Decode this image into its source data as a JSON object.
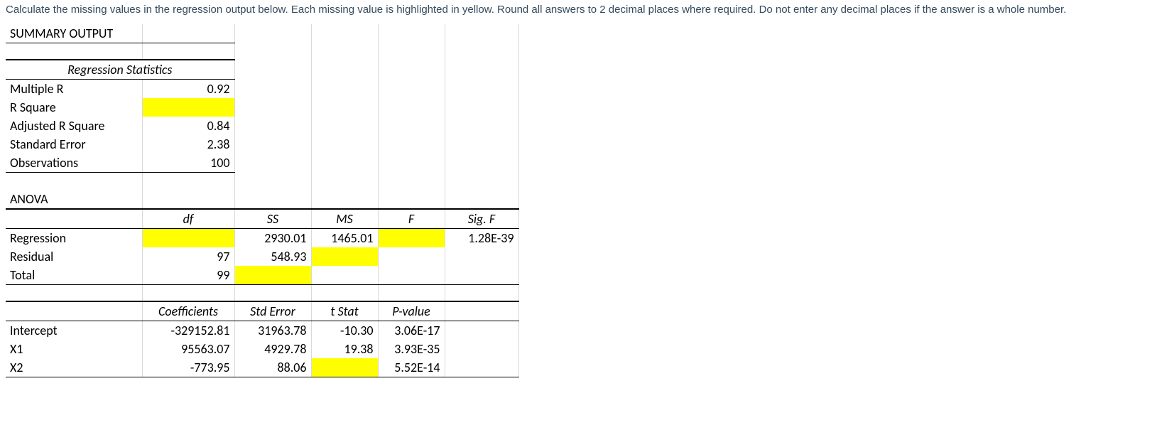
{
  "instruction": "Calculate the missing values in the regression output below. Each missing value is highlighted in yellow. Round all answers to 2 decimal places where required. Do not enter any decimal places if the answer is a whole number.",
  "summary_output": "SUMMARY OUTPUT",
  "reg_stats_header": "Regression Statistics",
  "stats": {
    "multiple_r": {
      "label": "Multiple R",
      "value": "0.92"
    },
    "r_square": {
      "label": "R Square",
      "value": ""
    },
    "adj_r_square": {
      "label": "Adjusted R Square",
      "value": "0.84"
    },
    "std_error": {
      "label": "Standard Error",
      "value": "2.38"
    },
    "observations": {
      "label": "Observations",
      "value": "100"
    }
  },
  "anova": {
    "title": "ANOVA",
    "headers": {
      "df": "df",
      "ss": "SS",
      "ms": "MS",
      "f": "F",
      "sigf": "Sig. F"
    },
    "rows": {
      "regression": {
        "label": "Regression",
        "df": "",
        "ss": "2930.01",
        "ms": "1465.01",
        "f": "",
        "sigf": "1.28E-39"
      },
      "residual": {
        "label": "Residual",
        "df": "97",
        "ss": "548.93",
        "ms": "",
        "f": "",
        "sigf": ""
      },
      "total": {
        "label": "Total",
        "df": "99",
        "ss": "",
        "ms": "",
        "f": "",
        "sigf": ""
      }
    }
  },
  "coef": {
    "headers": {
      "coef": "Coefficients",
      "se": "Std Error",
      "t": "t Stat",
      "p": "P-value"
    },
    "rows": {
      "intercept": {
        "label": "Intercept",
        "coef": "-329152.81",
        "se": "31963.78",
        "t": "-10.30",
        "p": "3.06E-17"
      },
      "x1": {
        "label": "X1",
        "coef": "95563.07",
        "se": "4929.78",
        "t": "19.38",
        "p": "3.93E-35"
      },
      "x2": {
        "label": "X2",
        "coef": "-773.95",
        "se": "88.06",
        "t": "",
        "p": "5.52E-14"
      }
    }
  },
  "chart_data": {
    "type": "table",
    "title": "Regression SUMMARY OUTPUT (missing cells highlighted)",
    "regression_statistics": {
      "Multiple R": 0.92,
      "R Square": null,
      "Adjusted R Square": 0.84,
      "Standard Error": 2.38,
      "Observations": 100
    },
    "anova": {
      "columns": [
        "",
        "df",
        "SS",
        "MS",
        "F",
        "Sig. F"
      ],
      "rows": [
        [
          "Regression",
          null,
          2930.01,
          1465.01,
          null,
          "1.28E-39"
        ],
        [
          "Residual",
          97,
          548.93,
          null,
          "",
          ""
        ],
        [
          "Total",
          99,
          null,
          "",
          "",
          ""
        ]
      ]
    },
    "coefficients": {
      "columns": [
        "",
        "Coefficients",
        "Std Error",
        "t Stat",
        "P-value"
      ],
      "rows": [
        [
          "Intercept",
          -329152.81,
          31963.78,
          -10.3,
          "3.06E-17"
        ],
        [
          "X1",
          95563.07,
          4929.78,
          19.38,
          "3.93E-35"
        ],
        [
          "X2",
          -773.95,
          88.06,
          null,
          "5.52E-14"
        ]
      ]
    },
    "highlighted_missing": [
      "R Square",
      "ANOVA Regression df",
      "ANOVA Regression F",
      "ANOVA Residual MS",
      "ANOVA Total SS",
      "Coefficients X2 t Stat"
    ]
  }
}
